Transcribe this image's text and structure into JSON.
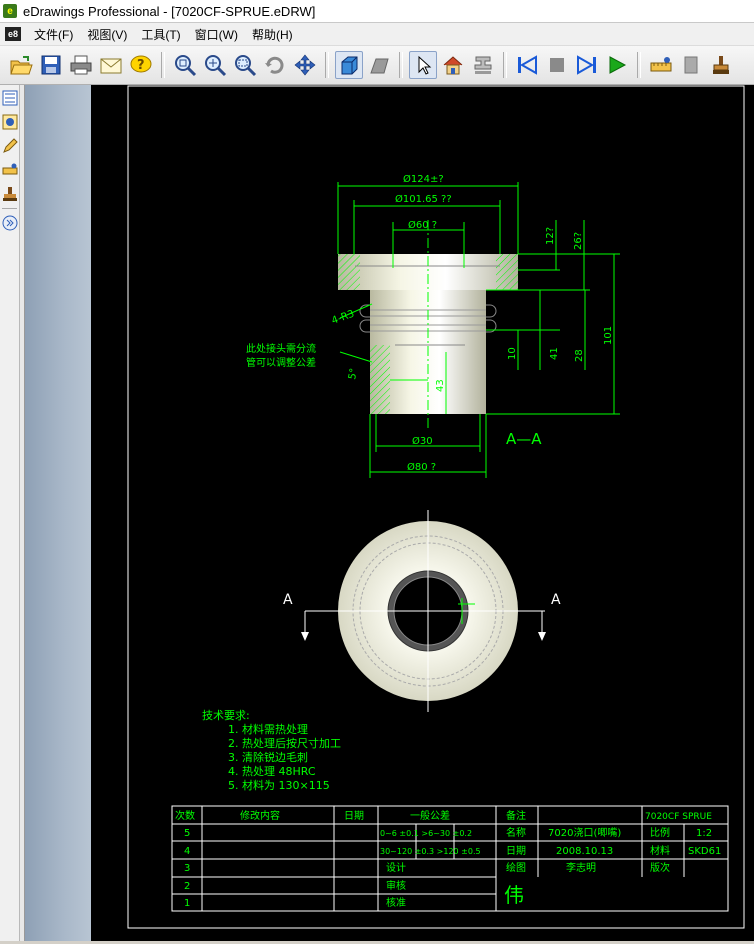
{
  "window": {
    "title": "eDrawings Professional - [7020CF-SPRUE.eDRW]",
    "logo_text": "e"
  },
  "menu": {
    "logo_text": "e8",
    "items": [
      "文件(F)",
      "视图(V)",
      "工具(T)",
      "窗口(W)",
      "帮助(H)"
    ]
  },
  "toolbar": {
    "buttons": [
      "open-icon",
      "save-icon",
      "print-icon",
      "email-icon",
      "help-icon",
      "zoom-to-fit-icon",
      "zoom-in-out-icon",
      "zoom-area-icon",
      "rotate-icon",
      "pan-icon",
      "shaded-icon",
      "perspective-icon",
      "select-icon",
      "home-icon",
      "section-icon",
      "first-frame-icon",
      "stop-icon",
      "next-frame-icon",
      "play-icon",
      "measure-icon",
      "mark-icon",
      "stamp-icon"
    ]
  },
  "leftbar": {
    "buttons": [
      "sheet-tree-icon",
      "configurations-icon",
      "markup-icon",
      "measure-icon",
      "stamp-icon",
      "expand-icon"
    ]
  },
  "colors": {
    "line": "#00ff00",
    "dim": "#00ff00",
    "frame": "#ffffff",
    "part": "#e8e8d2"
  },
  "drawing": {
    "section_label": "A—A",
    "section_mark_left": "A",
    "section_mark_right": "A",
    "dims": {
      "d1": "Ø124±?",
      "d2": "Ø101.65 ??",
      "d3": "Ø60 ?",
      "d4": "Ø30",
      "d5": "Ø80 ?",
      "v1": "12?",
      "v2": "26?",
      "v3": "10",
      "v4": "41",
      "v5": "28",
      "v6": "101",
      "v7": "43",
      "chamfer": "4-R3",
      "note_left": "5°"
    },
    "callout": [
      "此处接头需分流",
      "管可以调整公差"
    ],
    "notes_title": "技术要求:",
    "notes": [
      "1. 材料需热处理",
      "2. 热处理后按尺寸加工",
      "3. 清除锐边毛刺",
      "4. 热处理 48HRC",
      "5. 材料为 130×115"
    ]
  },
  "title_block": {
    "header": [
      "次数",
      "修改内容",
      "日期",
      "一般公差",
      "备注",
      "",
      "7020CF SPRUE"
    ],
    "row5": [
      "5",
      "",
      "",
      "0~6  ±0.1  >6~30  ±0.2",
      "名称",
      "7020浇口(唧嘴)",
      "比例",
      "1:2"
    ],
    "row4": [
      "4",
      "",
      "",
      "30~120 ±0.3  >120 ±0.5",
      "日期",
      "2008.10.13",
      "材料",
      "SKD61"
    ],
    "row3": [
      "3",
      "",
      "",
      "设计",
      "绘图",
      "李志明",
      "版次",
      ""
    ],
    "row2": [
      "2",
      "",
      "",
      "审核",
      "",
      "",
      "",
      ""
    ],
    "row1": [
      "1",
      "",
      "",
      "核准",
      "",
      "",
      "",
      ""
    ],
    "logo": "伟"
  }
}
